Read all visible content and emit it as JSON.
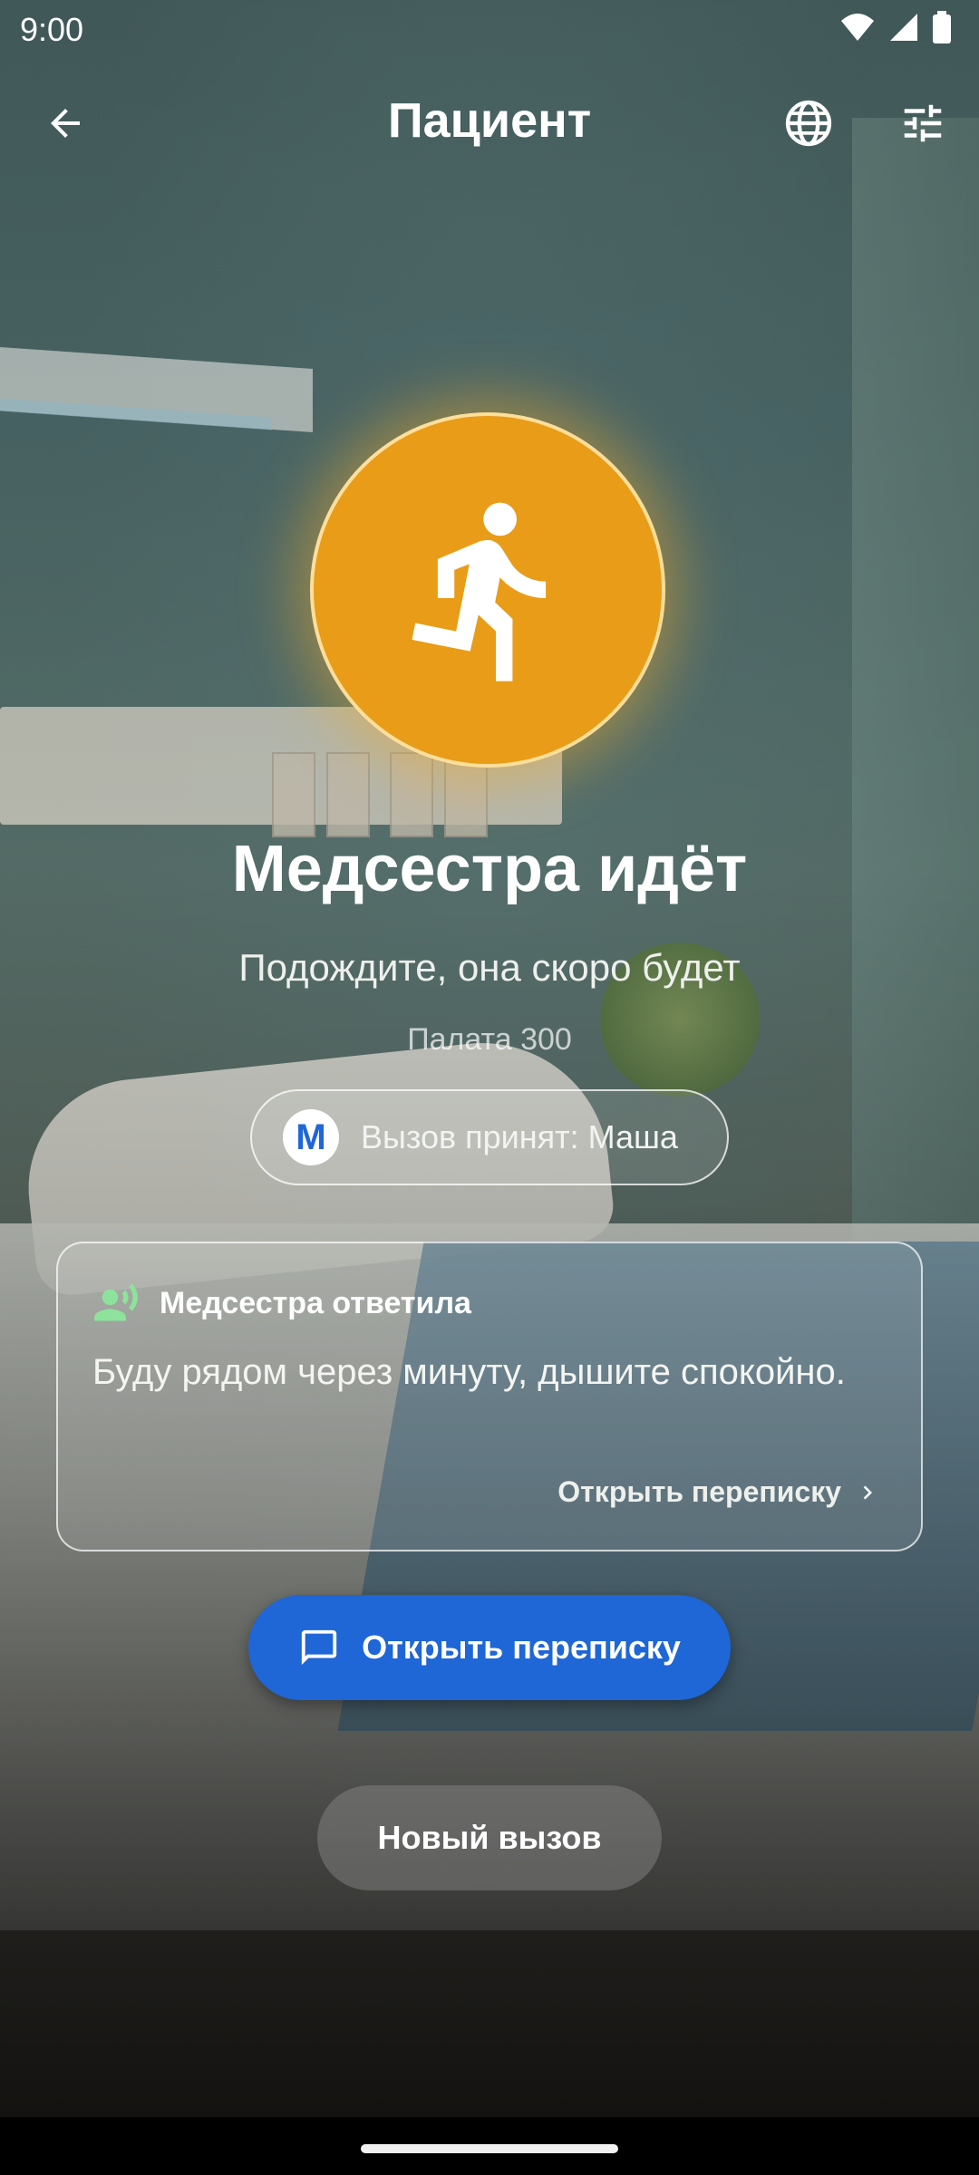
{
  "status_bar": {
    "time": "9:00"
  },
  "app_bar": {
    "title": "Пациент"
  },
  "icons": {
    "back": "arrow-back-icon",
    "language": "globe-icon",
    "settings": "tune-icon",
    "status": "running-person-icon",
    "reply": "record-voice-icon",
    "chat": "chat-bubble-icon",
    "chevron": "chevron-right-icon"
  },
  "status": {
    "headline": "Медсестра идёт",
    "subline": "Подождите, она скоро будет",
    "room": "Палата 300",
    "circle_color": "#E89C18"
  },
  "accepted": {
    "avatar_letter": "М",
    "text": "Вызов принят: Маша"
  },
  "reply_card": {
    "title": "Медсестра ответила",
    "message": "Буду рядом через минуту, дышите спокойно.",
    "link": "Открыть переписку"
  },
  "buttons": {
    "open_chat": "Открыть переписку",
    "new_call": "Новый вызов"
  },
  "colors": {
    "primary": "#1F66D6",
    "accent_green": "#8EE39C"
  }
}
